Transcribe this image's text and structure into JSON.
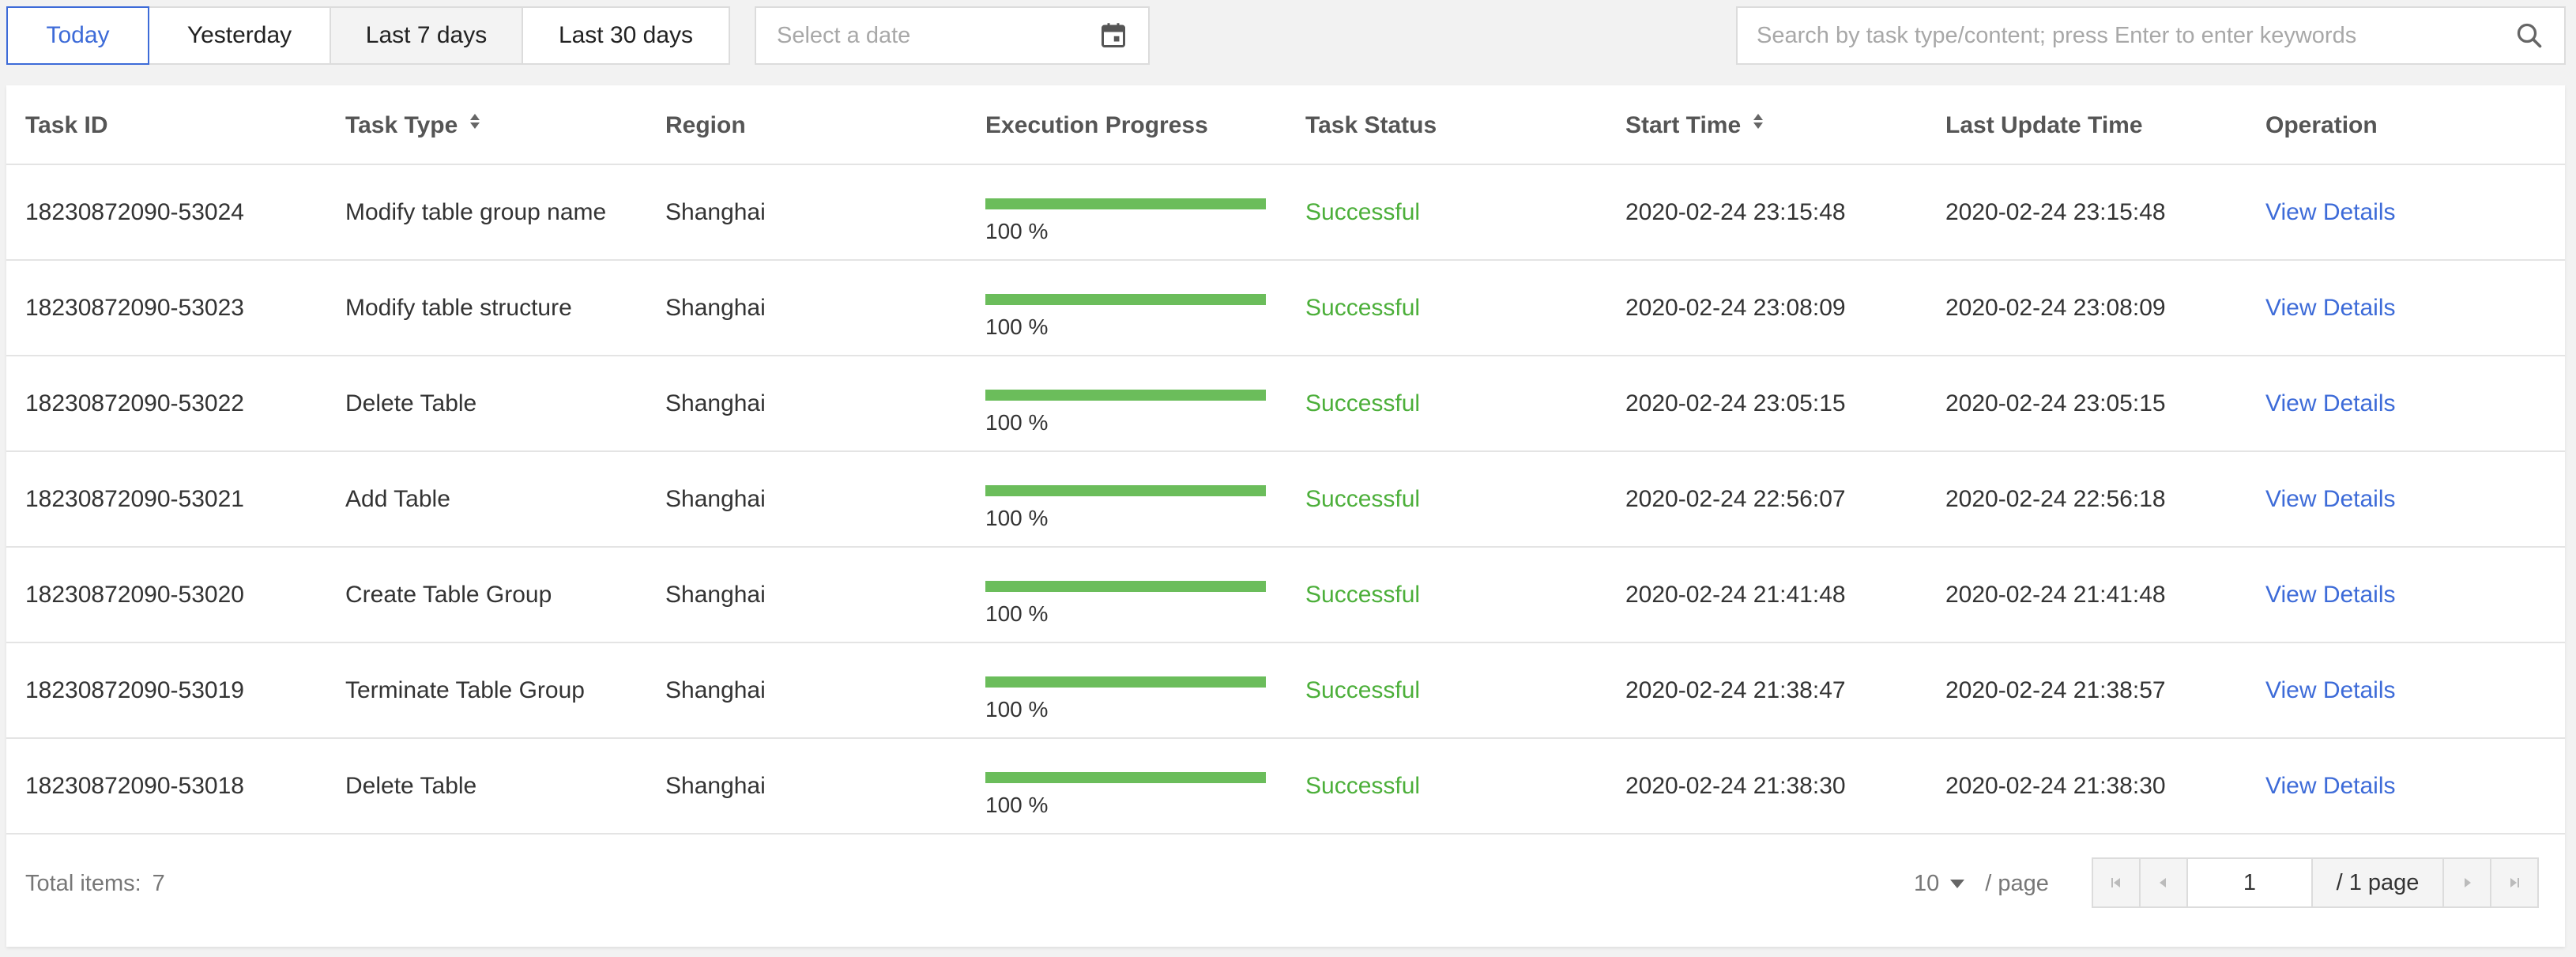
{
  "toolbar": {
    "ranges": [
      "Today",
      "Yesterday",
      "Last 7 days",
      "Last 30 days"
    ],
    "date_placeholder": "Select a date",
    "search_placeholder": "Search by task type/content; press Enter to enter keywords"
  },
  "table": {
    "headers": {
      "task_id": "Task ID",
      "task_type": "Task Type",
      "region": "Region",
      "progress": "Execution Progress",
      "status": "Task Status",
      "start_time": "Start Time",
      "last_update": "Last Update Time",
      "operation": "Operation"
    },
    "rows": [
      {
        "task_id": "18230872090-53024",
        "task_type": "Modify table group name",
        "region": "Shanghai",
        "progress": 100,
        "progress_label": "100 %",
        "status": "Successful",
        "start_time": "2020-02-24 23:15:48",
        "last_update": "2020-02-24 23:15:48",
        "operation": "View Details"
      },
      {
        "task_id": "18230872090-53023",
        "task_type": "Modify table structure",
        "region": "Shanghai",
        "progress": 100,
        "progress_label": "100 %",
        "status": "Successful",
        "start_time": "2020-02-24 23:08:09",
        "last_update": "2020-02-24 23:08:09",
        "operation": "View Details"
      },
      {
        "task_id": "18230872090-53022",
        "task_type": "Delete Table",
        "region": "Shanghai",
        "progress": 100,
        "progress_label": "100 %",
        "status": "Successful",
        "start_time": "2020-02-24 23:05:15",
        "last_update": "2020-02-24 23:05:15",
        "operation": "View Details"
      },
      {
        "task_id": "18230872090-53021",
        "task_type": "Add Table",
        "region": "Shanghai",
        "progress": 100,
        "progress_label": "100 %",
        "status": "Successful",
        "start_time": "2020-02-24 22:56:07",
        "last_update": "2020-02-24 22:56:18",
        "operation": "View Details"
      },
      {
        "task_id": "18230872090-53020",
        "task_type": "Create Table Group",
        "region": "Shanghai",
        "progress": 100,
        "progress_label": "100 %",
        "status": "Successful",
        "start_time": "2020-02-24 21:41:48",
        "last_update": "2020-02-24 21:41:48",
        "operation": "View Details"
      },
      {
        "task_id": "18230872090-53019",
        "task_type": "Terminate Table Group",
        "region": "Shanghai",
        "progress": 100,
        "progress_label": "100 %",
        "status": "Successful",
        "start_time": "2020-02-24 21:38:47",
        "last_update": "2020-02-24 21:38:57",
        "operation": "View Details"
      },
      {
        "task_id": "18230872090-53018",
        "task_type": "Delete Table",
        "region": "Shanghai",
        "progress": 100,
        "progress_label": "100 %",
        "status": "Successful",
        "start_time": "2020-02-24 21:38:30",
        "last_update": "2020-02-24 21:38:30",
        "operation": "View Details"
      }
    ]
  },
  "footer": {
    "total_label": "Total items:",
    "total_count": "7",
    "page_size": "10",
    "per_page_label": "/ page",
    "current_page": "1",
    "total_pages_label": "/ 1 page"
  },
  "icons": {
    "calendar": "calendar-icon",
    "search": "search-icon",
    "sort": "sort-icon",
    "first": "first-page-icon",
    "prev": "prev-page-icon",
    "next": "next-page-icon",
    "last": "last-page-icon"
  },
  "colors": {
    "accent": "#3d6bd8",
    "success": "#4caf3a",
    "progress": "#6bbd5b"
  }
}
